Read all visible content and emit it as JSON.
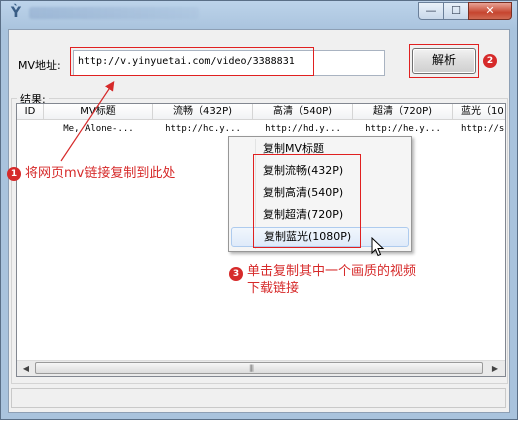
{
  "window": {
    "close_glyph": "✕",
    "min_glyph": "—",
    "max_glyph": "☐",
    "icon": "app-icon"
  },
  "form": {
    "url_label": "MV地址:",
    "url_value": "http://v.yinyuetai.com/video/3388831",
    "parse_button": "解析",
    "results_label": "结果:"
  },
  "table": {
    "columns": [
      "ID",
      "MV标题",
      "流畅（432P)",
      "高清（540P)",
      "超清（720P)",
      "蓝光（10"
    ],
    "rows": [
      [
        "",
        "Me, Alone-...",
        "http://hc.y...",
        "http://hd.y...",
        "http://he.y...",
        "http://sh"
      ]
    ]
  },
  "context_menu": {
    "items": [
      "复制MV标题",
      "复制流畅(432P)",
      "复制高清(540P)",
      "复制超清(720P)",
      "复制蓝光(1080P)"
    ]
  },
  "annotations": {
    "badges": [
      "1",
      "2",
      "3"
    ],
    "note_1": "将网页mv链接复制到此处",
    "note_3_line1": "单击复制其中一个画质的视频",
    "note_3_line2": "下载链接"
  },
  "scrollbar": {
    "left_glyph": "◀",
    "right_glyph": "▶",
    "grip": "|||"
  },
  "colors": {
    "annotation_red": "#d62a2a",
    "menu_highlight": "#dfeafa"
  }
}
